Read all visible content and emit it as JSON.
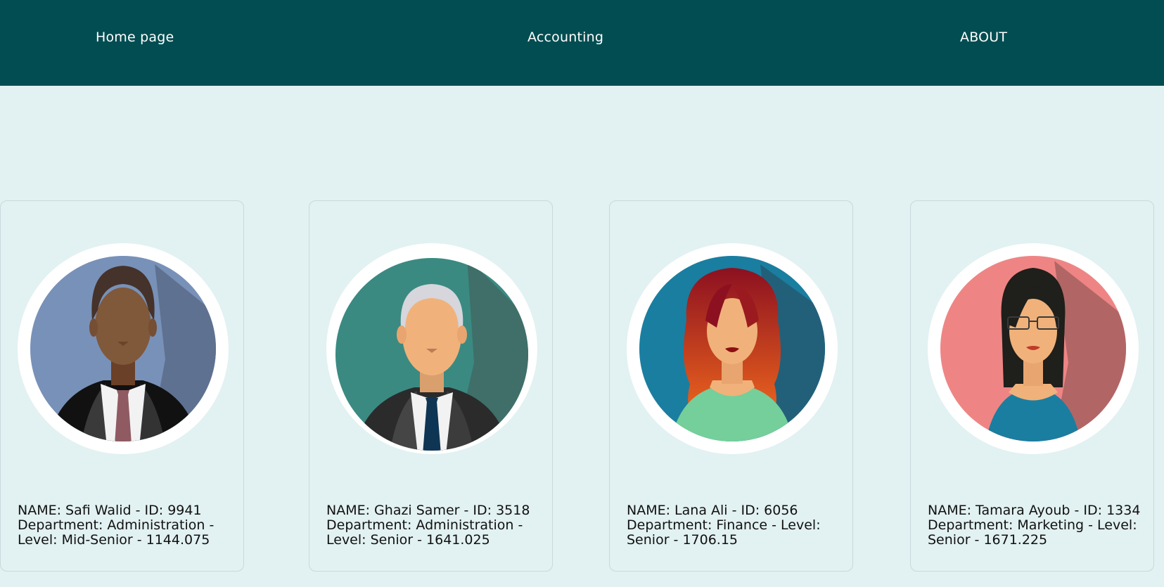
{
  "nav": {
    "home": "Home page",
    "accounting": "Accounting",
    "about": "ABOUT"
  },
  "employees": [
    {
      "info": "NAME: Ghazi Samer - ID: 3518 Department: Administration - Level: Senior - 1641.025",
      "avatar": "man-gray-hair-avatar-icon"
    },
    {
      "info": "NAME: Lana Ali - ID: 6056 Department: Finance - Level: Senior - 1706.15",
      "avatar": "woman-red-hair-avatar-icon"
    },
    {
      "info": "NAME: Tamara Ayoub - ID: 1334 Department: Marketing - Level: Senior - 1671.225",
      "avatar": "woman-glasses-avatar-icon"
    },
    {
      "info": "NAME: Safi Walid - ID: 9941 Department: Administration - Level: Mid-Senior - 1144.075",
      "avatar": "man-dark-skin-avatar-icon"
    }
  ],
  "colors": {
    "nav_bg": "#024d51",
    "page_bg": "#e2f1f1",
    "nav_text": "#ffffff"
  }
}
